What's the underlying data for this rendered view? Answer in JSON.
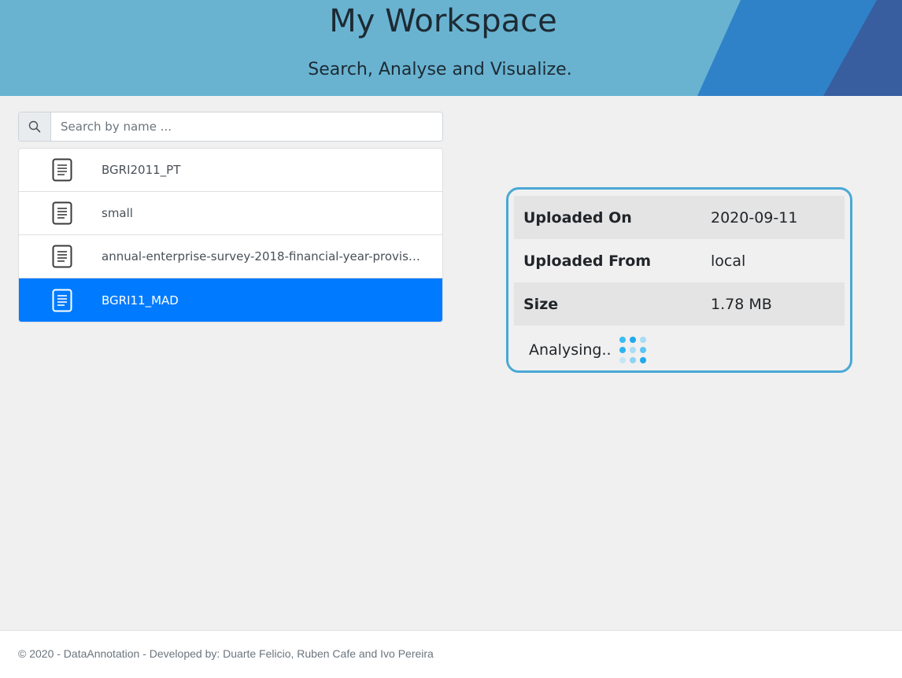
{
  "header": {
    "title": "My Workspace",
    "subtitle": "Search, Analyse and Visualize."
  },
  "search": {
    "icon": "search-icon",
    "placeholder": "Search by name ...",
    "value": ""
  },
  "files": [
    {
      "name": "BGRI2011_PT",
      "icon": "document-icon",
      "selected": false
    },
    {
      "name": "small",
      "icon": "document-icon",
      "selected": false
    },
    {
      "name": "annual-enterprise-survey-2018-financial-year-provisi...",
      "icon": "document-icon",
      "selected": false
    },
    {
      "name": "BGRI11_MAD",
      "icon": "document-icon",
      "selected": true
    }
  ],
  "details": {
    "uploaded_on_label": "Uploaded On",
    "uploaded_on_value": "2020-09-11",
    "uploaded_from_label": "Uploaded From",
    "uploaded_from_value": "local",
    "size_label": "Size",
    "size_value": "1.78 MB",
    "status_text": "Analysing.."
  },
  "footer": {
    "text": "© 2020 - DataAnnotation - Developed by: Duarte Felicio, Ruben Cafe and Ivo Pereira"
  },
  "colors": {
    "header_bg": "#69b3d1",
    "accent_blue": "#2f82c8",
    "dark_blue": "#385e9f",
    "selected_bg": "#007bff",
    "card_border": "#4aa8d4",
    "spinner": "#29b6f6"
  }
}
